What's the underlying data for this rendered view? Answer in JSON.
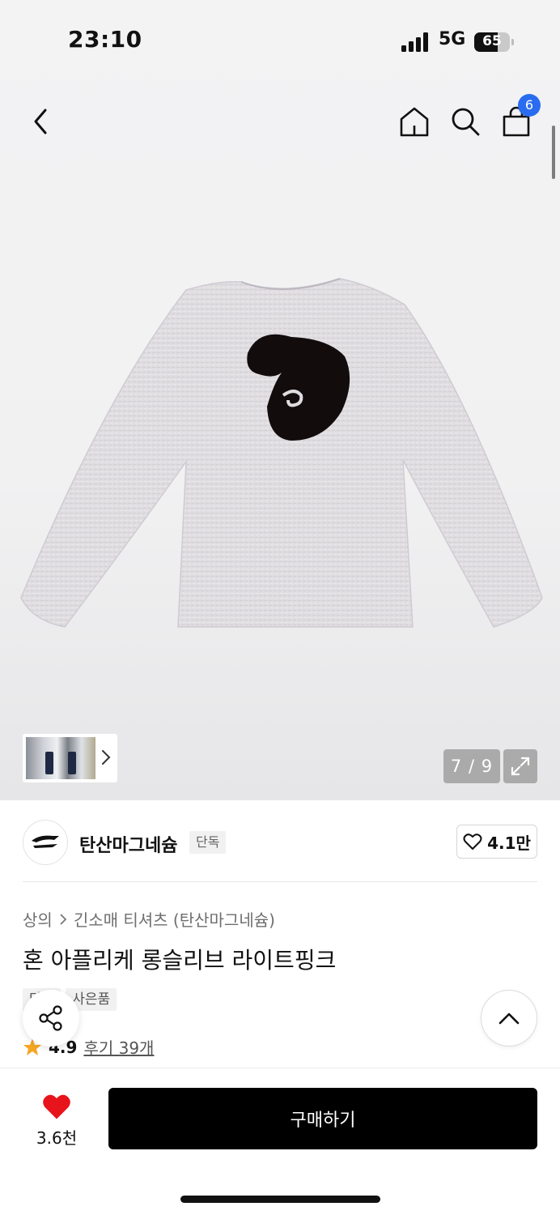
{
  "status_bar": {
    "time": "23:10",
    "network": "5G",
    "battery": "65"
  },
  "nav": {
    "cart_count": "6"
  },
  "gallery": {
    "counter": "7 / 9"
  },
  "brand": {
    "name": "탄산마그네슘",
    "tag": "단독",
    "likes": "4.1만"
  },
  "product": {
    "breadcrumb": [
      "상의",
      "긴소매 티셔츠 (탄산마그네슘)"
    ],
    "title": "혼 아플리케 롱슬리브 라이트핑크",
    "tags": [
      "단독",
      "사은품"
    ],
    "rating": "4.9",
    "reviews": "후기 39개"
  },
  "bottom_bar": {
    "wish_count": "3.6천",
    "buy_label": "구매하기"
  },
  "colors": {
    "accent": "#2a6cf0",
    "heart": "#e8141b",
    "buy_button": "#000000"
  }
}
